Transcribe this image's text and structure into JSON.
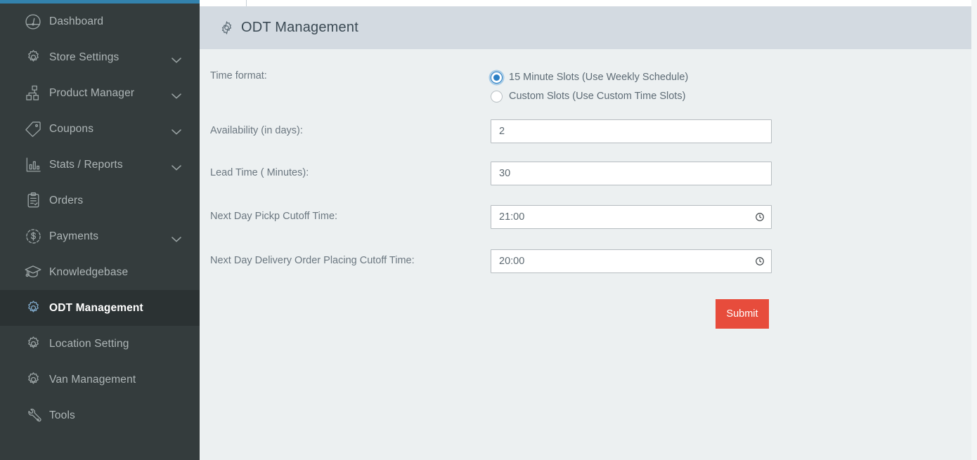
{
  "theme": {
    "sidebar_bg": "#343c3d",
    "sidebar_active_bg": "#2b3233",
    "sidebar_accent_top": "#3382ad",
    "header_bg": "#d3dae1",
    "content_bg": "#ecf0f1",
    "accent_blue": "#2b7fc4",
    "submit_red": "#e74c3c"
  },
  "sidebar": {
    "items": [
      {
        "label": "Dashboard",
        "icon": "dashboard-gauge-icon",
        "expandable": false,
        "active": false
      },
      {
        "label": "Store Settings",
        "icon": "gear-icon",
        "expandable": true,
        "active": false
      },
      {
        "label": "Product Manager",
        "icon": "blocks-icon",
        "expandable": true,
        "active": false
      },
      {
        "label": "Coupons",
        "icon": "tag-icon",
        "expandable": true,
        "active": false
      },
      {
        "label": "Stats / Reports",
        "icon": "bar-chart-icon",
        "expandable": true,
        "active": false
      },
      {
        "label": "Orders",
        "icon": "clipboard-icon",
        "expandable": false,
        "active": false
      },
      {
        "label": "Payments",
        "icon": "dollar-circle-icon",
        "expandable": true,
        "active": false
      },
      {
        "label": "Knowledgebase",
        "icon": "graduation-cap-icon",
        "expandable": false,
        "active": false
      },
      {
        "label": "ODT Management",
        "icon": "gear-icon",
        "expandable": false,
        "active": true
      },
      {
        "label": "Location Setting",
        "icon": "gear-icon",
        "expandable": false,
        "active": false
      },
      {
        "label": "Van Management",
        "icon": "gear-icon",
        "expandable": false,
        "active": false
      },
      {
        "label": "Tools",
        "icon": "wrench-icon",
        "expandable": false,
        "active": false
      }
    ]
  },
  "header": {
    "title": "ODT Management",
    "icon": "gear-icon"
  },
  "form": {
    "time_format": {
      "label": "Time format:",
      "options": [
        {
          "label": "15 Minute Slots (Use Weekly Schedule)",
          "selected": true
        },
        {
          "label": "Custom Slots (Use Custom Time Slots)",
          "selected": false
        }
      ]
    },
    "availability": {
      "label": "Availability (in days):",
      "value": "2"
    },
    "lead_time": {
      "label": "Lead Time ( Minutes):",
      "value": "30"
    },
    "pickup_cutoff": {
      "label": "Next Day Pickp Cutoff Time:",
      "value": "21:00",
      "icon": "clock-icon"
    },
    "delivery_cutoff": {
      "label": "Next Day Delivery Order Placing Cutoff Time:",
      "value": "20:00",
      "icon": "clock-icon"
    },
    "submit_label": "Submit"
  }
}
